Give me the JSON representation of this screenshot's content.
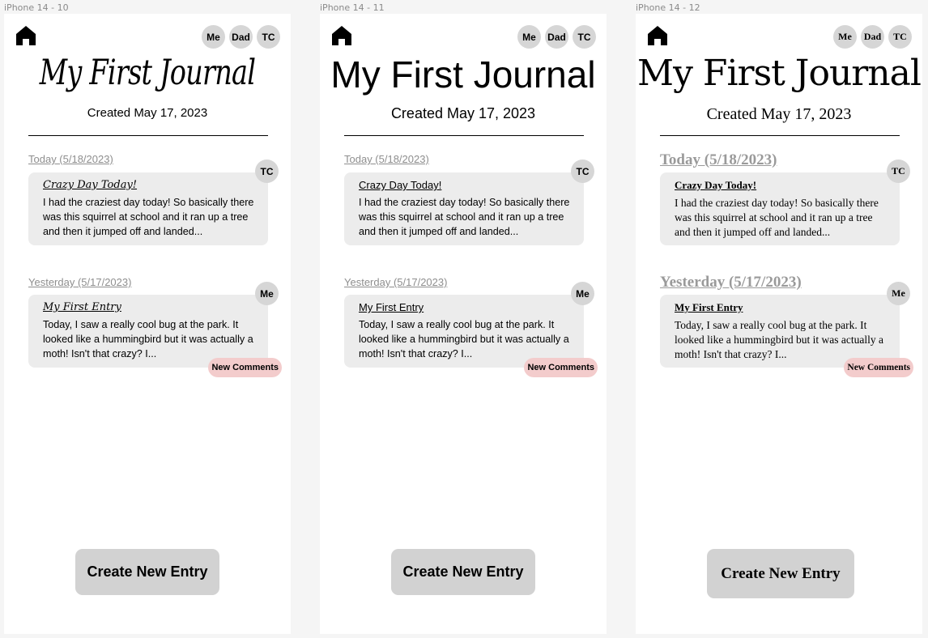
{
  "frames": [
    {
      "label": "iPhone 14 - 10",
      "avatars": [
        "Me",
        "Dad",
        "TC"
      ],
      "title": "My First Journal",
      "created": "Created May 17, 2023",
      "entries": [
        {
          "date": "Today (5/18/2023)",
          "avatar": "TC",
          "title": "Crazy Day Today!",
          "body": "I had the craziest day today! So basically there was this squirrel at school and it ran up a tree and then it jumped off and landed..."
        },
        {
          "date": "Yesterday (5/17/2023)",
          "avatar": "Me",
          "title": "My First Entry",
          "body": "Today, I saw a really cool bug at the park. It looked like a hummingbird but it was actually a moth! Isn't that crazy? I...",
          "badge": "New Comments"
        }
      ],
      "create_label": "Create New Entry"
    },
    {
      "label": "iPhone 14 - 11",
      "avatars": [
        "Me",
        "Dad",
        "TC"
      ],
      "title": "My First Journal",
      "created": "Created May 17, 2023",
      "entries": [
        {
          "date": "Today (5/18/2023)",
          "avatar": "TC",
          "title": "Crazy Day Today!",
          "body": "I had the craziest day today! So basically there was this squirrel at school and it ran up a tree and then it jumped off and landed..."
        },
        {
          "date": "Yesterday (5/17/2023)",
          "avatar": "Me",
          "title": "My First Entry",
          "body": "Today, I saw a really cool bug at the park. It looked like a hummingbird but it was actually a moth! Isn't that crazy? I...",
          "badge": "New Comments"
        }
      ],
      "create_label": "Create New Entry"
    },
    {
      "label": "iPhone 14 - 12",
      "avatars": [
        "Me",
        "Dad",
        "TC"
      ],
      "title": "My First Journal",
      "created": "Created May 17, 2023",
      "entries": [
        {
          "date": "Today (5/18/2023)",
          "avatar": "TC",
          "title": "Crazy Day Today!",
          "body": "I had the craziest day today! So basically there was this squirrel at school and it ran up a tree and then it jumped off and landed..."
        },
        {
          "date": "Yesterday (5/17/2023)",
          "avatar": "Me",
          "title": "My First Entry",
          "body": "Today, I saw a really cool bug at the park. It looked like a hummingbird but it was actually a moth! Isn't that crazy? I...",
          "badge": "New Comments"
        }
      ],
      "create_label": "Create New Entry"
    }
  ],
  "colors": {
    "canvas": "#f5f5f5",
    "screen": "#ffffff",
    "avatar": "#d6d6d6",
    "card": "#ececec",
    "badge": "#f3cccc",
    "button": "#d2d2d2",
    "date_label": "#8e8e8e"
  },
  "icons": {
    "home": "home-icon"
  }
}
